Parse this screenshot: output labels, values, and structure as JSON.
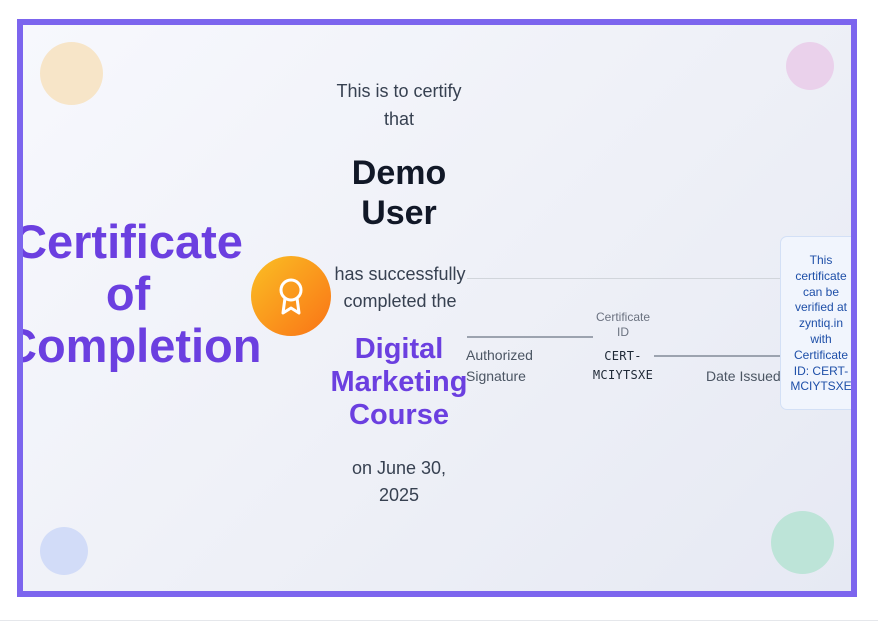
{
  "certificate": {
    "title_lines": [
      "Certificate",
      "of",
      "Completion"
    ],
    "certify_text": "This is to certify that",
    "recipient_name": "Demo User",
    "completed_text": "has successfully completed the",
    "course_name": "Digital Marketing Course",
    "date_text": "on June 30, 2025",
    "signature_label": "Authorized Signature",
    "certificate_id_label": "Certificate ID",
    "certificate_id_value": "CERT-MCIYTSXE",
    "date_issued_label": "Date Issued",
    "verification_note": "This certificate can be verified at zyntiq.in with Certificate ID: CERT-MCIYTSXE"
  },
  "colors": {
    "border": "#7c65ee",
    "accent": "#6b3fe0",
    "badge_start": "#fbbf24",
    "badge_end": "#f97316"
  },
  "icons": {
    "badge": "award-ribbon-icon"
  }
}
